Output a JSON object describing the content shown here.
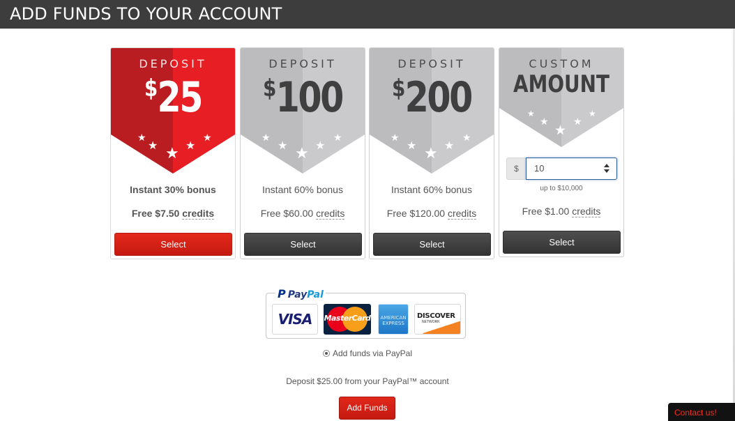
{
  "header": {
    "title": "ADD FUNDS TO YOUR ACCOUNT"
  },
  "colors": {
    "accent_red": "#e4291c",
    "ribbon_gray": "#c8c8c8",
    "header_bg": "#3d3d3d",
    "button_dark": "#3f3f3f"
  },
  "plans": [
    {
      "kicker": "DEPOSIT",
      "currency": "$",
      "amount": "25",
      "bonus": "Instant 30% bonus",
      "credits_prefix": "Free $7.50",
      "credits_word": "credits",
      "button": "Select",
      "selected": true
    },
    {
      "kicker": "DEPOSIT",
      "currency": "$",
      "amount": "100",
      "bonus": "Instant 60% bonus",
      "credits_prefix": "Free $60.00",
      "credits_word": "credits",
      "button": "Select",
      "selected": false
    },
    {
      "kicker": "DEPOSIT",
      "currency": "$",
      "amount": "200",
      "bonus": "Instant 60% bonus",
      "credits_prefix": "Free $120.00",
      "credits_word": "credits",
      "button": "Select",
      "selected": false
    }
  ],
  "custom": {
    "kicker": "CUSTOM",
    "title": "AMOUNT",
    "currency_addon": "$",
    "input_value": "10",
    "hint": "up to $10,000",
    "credits_prefix": "Free $1.00",
    "credits_word": "credits",
    "button": "Select"
  },
  "payment": {
    "paypal_brand_1": "Pay",
    "paypal_brand_2": "Pal",
    "cards": [
      "VISA",
      "MasterCard",
      "AMERICAN",
      "EXPRESS",
      "DISCOVER",
      "NETWORK"
    ],
    "radio_label": "Add funds via PayPal",
    "note": "Deposit $25.00 from your PayPal™ account",
    "submit": "Add Funds"
  },
  "contact": {
    "label": "Contact us!"
  }
}
